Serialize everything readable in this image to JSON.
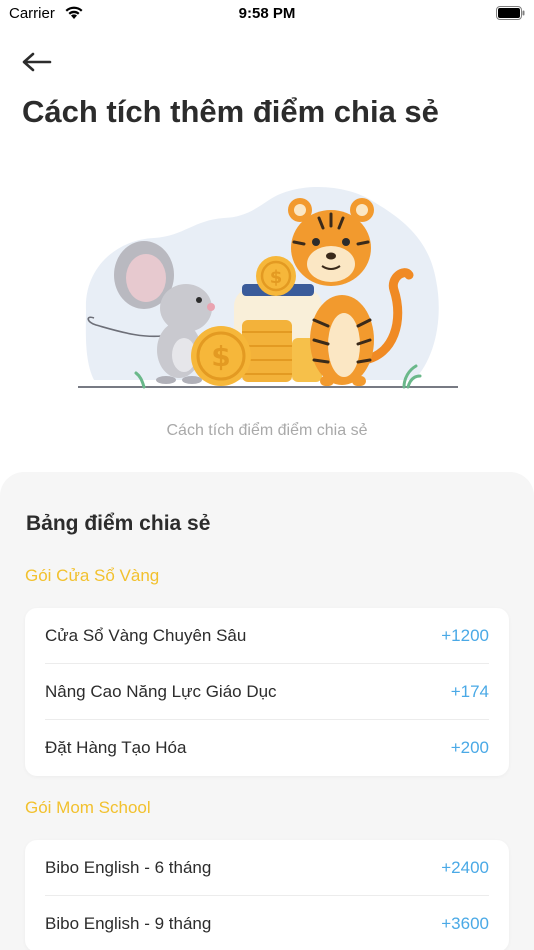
{
  "status_bar": {
    "carrier": "Carrier",
    "time": "9:58 PM"
  },
  "page": {
    "title": "Cách tích thêm điểm chia sẻ"
  },
  "hero": {
    "caption": "Cách tích điểm điểm chia sẻ"
  },
  "points_table": {
    "title": "Bảng điểm chia sẻ",
    "groups": [
      {
        "label": "Gói Cửa Sổ Vàng",
        "items": [
          {
            "name": "Cửa Sổ Vàng Chuyên Sâu",
            "points": "+1200"
          },
          {
            "name": "Nâng Cao Năng Lực Giáo Dục",
            "points": "+174"
          },
          {
            "name": "Đặt Hàng Tạo Hóa",
            "points": "+200"
          }
        ]
      },
      {
        "label": "Gói Mom School",
        "items": [
          {
            "name": "Bibo English - 6 tháng",
            "points": "+2400"
          },
          {
            "name": "Bibo English - 9 tháng",
            "points": "+3600"
          }
        ]
      }
    ]
  },
  "colors": {
    "accent_yellow": "#f2c12e",
    "points_blue": "#4aa9e6",
    "sheet_bg": "#f6f6f6"
  }
}
